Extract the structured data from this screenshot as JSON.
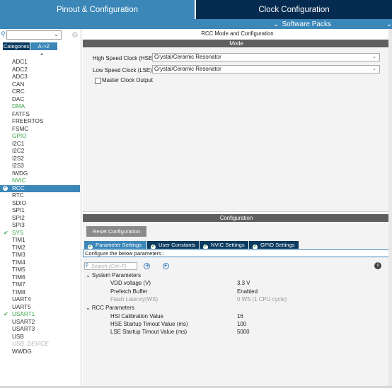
{
  "header": {
    "tab_pinout": "Pinout & Configuration",
    "tab_clock": "Clock Configuration",
    "software_packs": "Software Packs"
  },
  "left": {
    "seg_categories": "Categories",
    "seg_az": "A->Z",
    "items": [
      {
        "label": "ADC1",
        "state": "normal"
      },
      {
        "label": "ADC2",
        "state": "normal"
      },
      {
        "label": "ADC3",
        "state": "normal"
      },
      {
        "label": "CAN",
        "state": "normal"
      },
      {
        "label": "CRC",
        "state": "normal"
      },
      {
        "label": "DAC",
        "state": "normal"
      },
      {
        "label": "DMA",
        "state": "green"
      },
      {
        "label": "FATFS",
        "state": "normal"
      },
      {
        "label": "FREERTOS",
        "state": "normal"
      },
      {
        "label": "FSMC",
        "state": "normal"
      },
      {
        "label": "GPIO",
        "state": "green"
      },
      {
        "label": "I2C1",
        "state": "normal"
      },
      {
        "label": "I2C2",
        "state": "normal"
      },
      {
        "label": "I2S2",
        "state": "normal"
      },
      {
        "label": "I2S3",
        "state": "normal"
      },
      {
        "label": "IWDG",
        "state": "normal"
      },
      {
        "label": "NVIC",
        "state": "green"
      },
      {
        "label": "RCC",
        "state": "selected"
      },
      {
        "label": "RTC",
        "state": "normal"
      },
      {
        "label": "SDIO",
        "state": "normal"
      },
      {
        "label": "SPI1",
        "state": "normal"
      },
      {
        "label": "SPI2",
        "state": "normal"
      },
      {
        "label": "SPI3",
        "state": "normal"
      },
      {
        "label": "SYS",
        "state": "checked"
      },
      {
        "label": "TIM1",
        "state": "normal"
      },
      {
        "label": "TIM2",
        "state": "normal"
      },
      {
        "label": "TIM3",
        "state": "normal"
      },
      {
        "label": "TIM4",
        "state": "normal"
      },
      {
        "label": "TIM5",
        "state": "normal"
      },
      {
        "label": "TIM6",
        "state": "normal"
      },
      {
        "label": "TIM7",
        "state": "normal"
      },
      {
        "label": "TIM8",
        "state": "normal"
      },
      {
        "label": "UART4",
        "state": "normal"
      },
      {
        "label": "UART5",
        "state": "normal"
      },
      {
        "label": "USART1",
        "state": "checked"
      },
      {
        "label": "USART2",
        "state": "normal"
      },
      {
        "label": "USART3",
        "state": "normal"
      },
      {
        "label": "USB",
        "state": "normal"
      },
      {
        "label": "USB_DEVICE",
        "state": "disabled"
      },
      {
        "label": "WWDG",
        "state": "normal"
      }
    ]
  },
  "mode": {
    "title": "RCC Mode and Configuration",
    "bar": "Mode",
    "hse_label": "High Speed Clock (HSE)",
    "hse_value": "Crystal/Ceramic Resonator",
    "lse_label": "Low Speed Clock (LSE)",
    "lse_value": "Crystal/Ceramic Resonator",
    "mco_label": "Master Clock Output"
  },
  "config": {
    "bar": "Configuration",
    "reset_label": "Reset Configuration",
    "tabs": [
      "Parameter Settings",
      "User Constants",
      "NVIC Settings",
      "GPIO Settings"
    ],
    "below_text": "Configure the below parameters :",
    "search_placeholder": "Search (Ctrl+F)",
    "groups": [
      {
        "title": "System Parameters",
        "params": [
          {
            "name": "VDD voltage (V)",
            "value": "3.3 V"
          },
          {
            "name": "Prefetch Buffer",
            "value": "Enabled"
          },
          {
            "name": "Flash Latency(WS)",
            "value": "0 WS (1 CPU cycle)"
          }
        ]
      },
      {
        "title": "RCC Parameters",
        "params": [
          {
            "name": "HSI Calibration Value",
            "value": "16"
          },
          {
            "name": "HSE Startup Timout Value (ms)",
            "value": "100"
          },
          {
            "name": "LSE Startup Timout Value (ms)",
            "value": "5000"
          }
        ]
      }
    ]
  }
}
